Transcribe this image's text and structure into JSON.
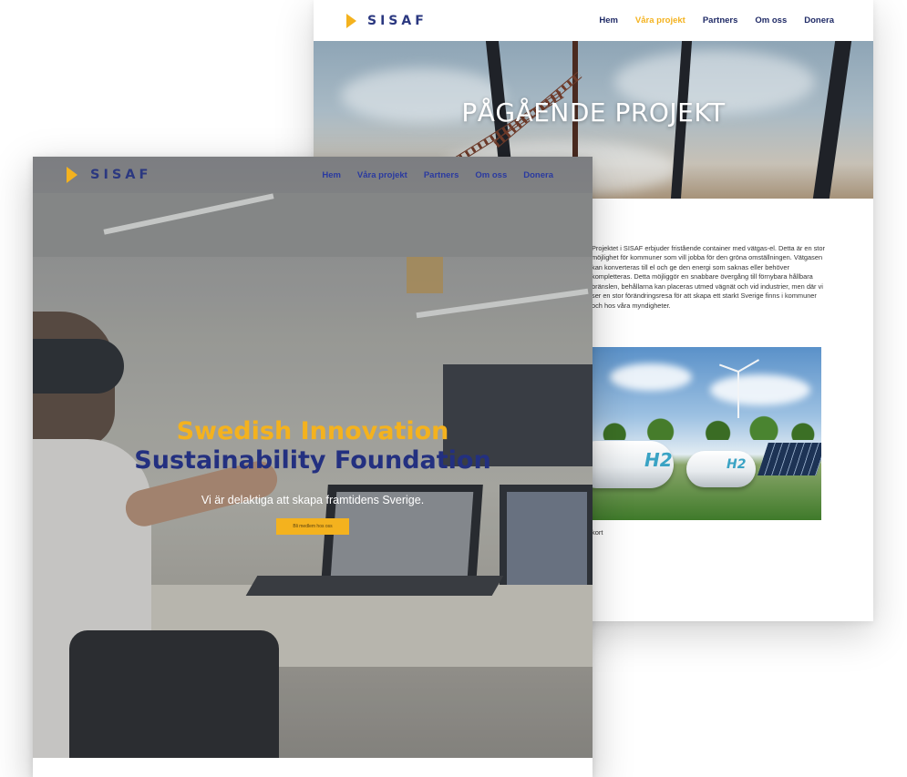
{
  "back_page": {
    "logo_text": "SISAF",
    "nav": [
      {
        "label": "Hem"
      },
      {
        "label": "Våra projekt"
      },
      {
        "label": "Partners"
      },
      {
        "label": "Om oss"
      },
      {
        "label": "Donera"
      }
    ],
    "active_nav": "Våra projekt",
    "hero_title": "PÅGÅENDE PROJEKT",
    "body_text": "Projektet i SISAF erbjuder fristående container med vätgas-el. Detta är en stor möjlighet för kommuner som vill jobba för den gröna omställningen. Vätgasen kan konverteras till el och ge den energi som saknas eller behöver kompletteras. Detta möjliggör en snabbare övergång till förnybara hållbara bränslen, behållarna kan placeras utmed vägnät och vid industrier, men där vi ser en stor förändringsresa för att skapa ett starkt Sverige finns i kommuner och hos våra myndigheter.",
    "image_labels": {
      "tank1": "H2",
      "tank2": "H2"
    },
    "caption": "kort"
  },
  "front_page": {
    "logo_text": "SISAF",
    "nav": [
      {
        "label": "Hem"
      },
      {
        "label": "Våra projekt"
      },
      {
        "label": "Partners"
      },
      {
        "label": "Om oss"
      },
      {
        "label": "Donera"
      }
    ],
    "hero_title_line1": "Swedish Innovation",
    "hero_title_line2": "Sustainability Foundation",
    "hero_subtitle": "Vi är delaktiga att skapa framtidens Sverige.",
    "cta_label": "Bli medlem hos oss"
  },
  "colors": {
    "brand_navy": "#233080",
    "accent_yellow": "#f4b21e",
    "nav_link": "#1f2a66"
  }
}
